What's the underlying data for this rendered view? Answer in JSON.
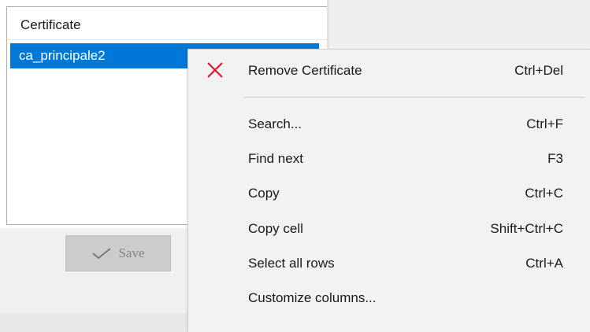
{
  "list": {
    "header": "Certificate",
    "rows": [
      "ca_principale2"
    ]
  },
  "save_button": {
    "label": "Save"
  },
  "context_menu": {
    "items": [
      {
        "label": "Remove Certificate",
        "shortcut": "Ctrl+Del",
        "icon": "close-icon"
      },
      {
        "label": "Search...",
        "shortcut": "Ctrl+F"
      },
      {
        "label": "Find next",
        "shortcut": "F3"
      },
      {
        "label": "Copy",
        "shortcut": "Ctrl+C"
      },
      {
        "label": "Copy cell",
        "shortcut": "Shift+Ctrl+C"
      },
      {
        "label": "Select all rows",
        "shortcut": "Ctrl+A"
      },
      {
        "label": "Customize columns...",
        "shortcut": ""
      }
    ]
  },
  "colors": {
    "selection": "#0078d7",
    "remove_icon": "#e81123",
    "menu_background": "#f2f2f2"
  }
}
